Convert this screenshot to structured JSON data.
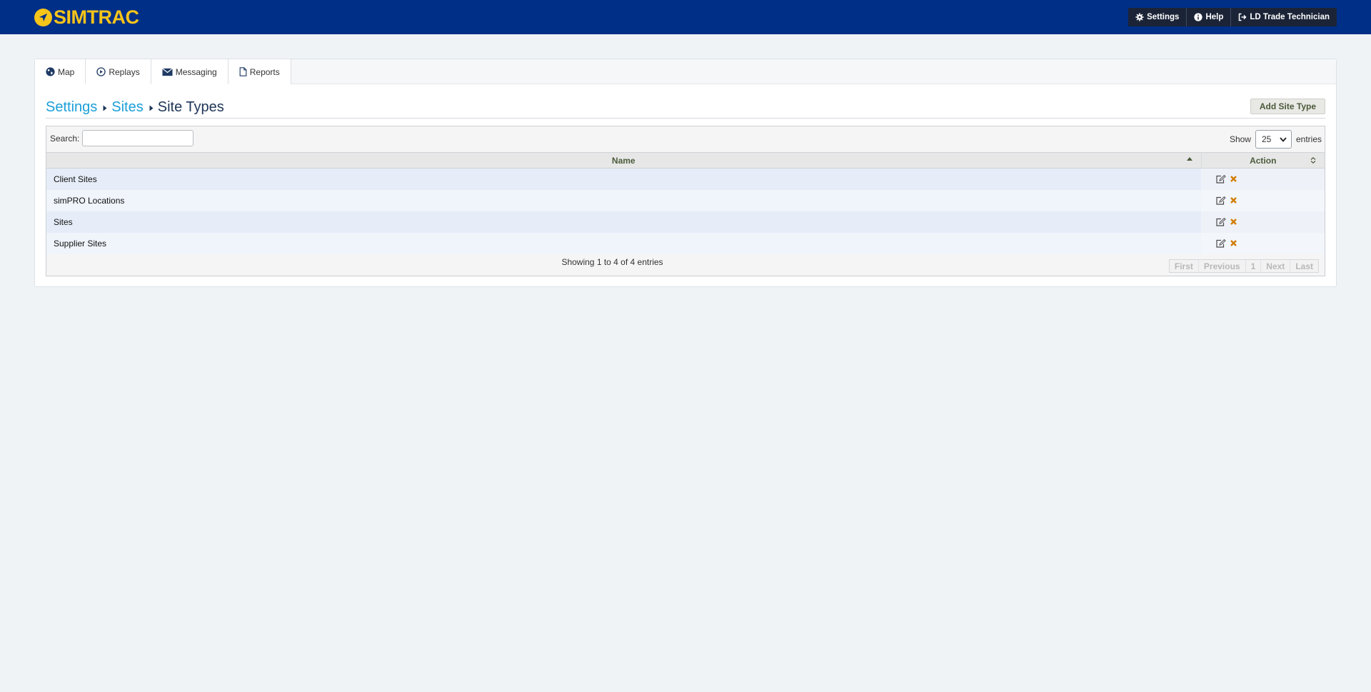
{
  "app": {
    "logo_text": "SIMTRAC",
    "brand_color": "#002f87",
    "logo_color": "#f7c41a"
  },
  "top_menu": {
    "settings_label": "Settings",
    "help_label": "Help",
    "user_label": "LD Trade Technician"
  },
  "tabs": [
    {
      "label": "Map",
      "icon": "globe-icon"
    },
    {
      "label": "Replays",
      "icon": "play-circle-icon"
    },
    {
      "label": "Messaging",
      "icon": "envelope-icon"
    },
    {
      "label": "Reports",
      "icon": "file-icon"
    }
  ],
  "breadcrumb": {
    "items": [
      "Settings",
      "Sites"
    ],
    "current": "Site Types"
  },
  "add_button_label": "Add Site Type",
  "table": {
    "search_label": "Search:",
    "search_value": "",
    "show_label": "Show",
    "page_size": "25",
    "entries_label": "entries",
    "columns": [
      "Name",
      "Action"
    ],
    "rows": [
      {
        "name": "Client Sites"
      },
      {
        "name": "simPRO Locations"
      },
      {
        "name": "Sites"
      },
      {
        "name": "Supplier Sites"
      }
    ],
    "row_actions": [
      "edit-icon",
      "delete-icon"
    ],
    "info_text": "Showing 1 to 4 of 4 entries",
    "pager": [
      "First",
      "Previous",
      "1",
      "Next",
      "Last"
    ]
  }
}
